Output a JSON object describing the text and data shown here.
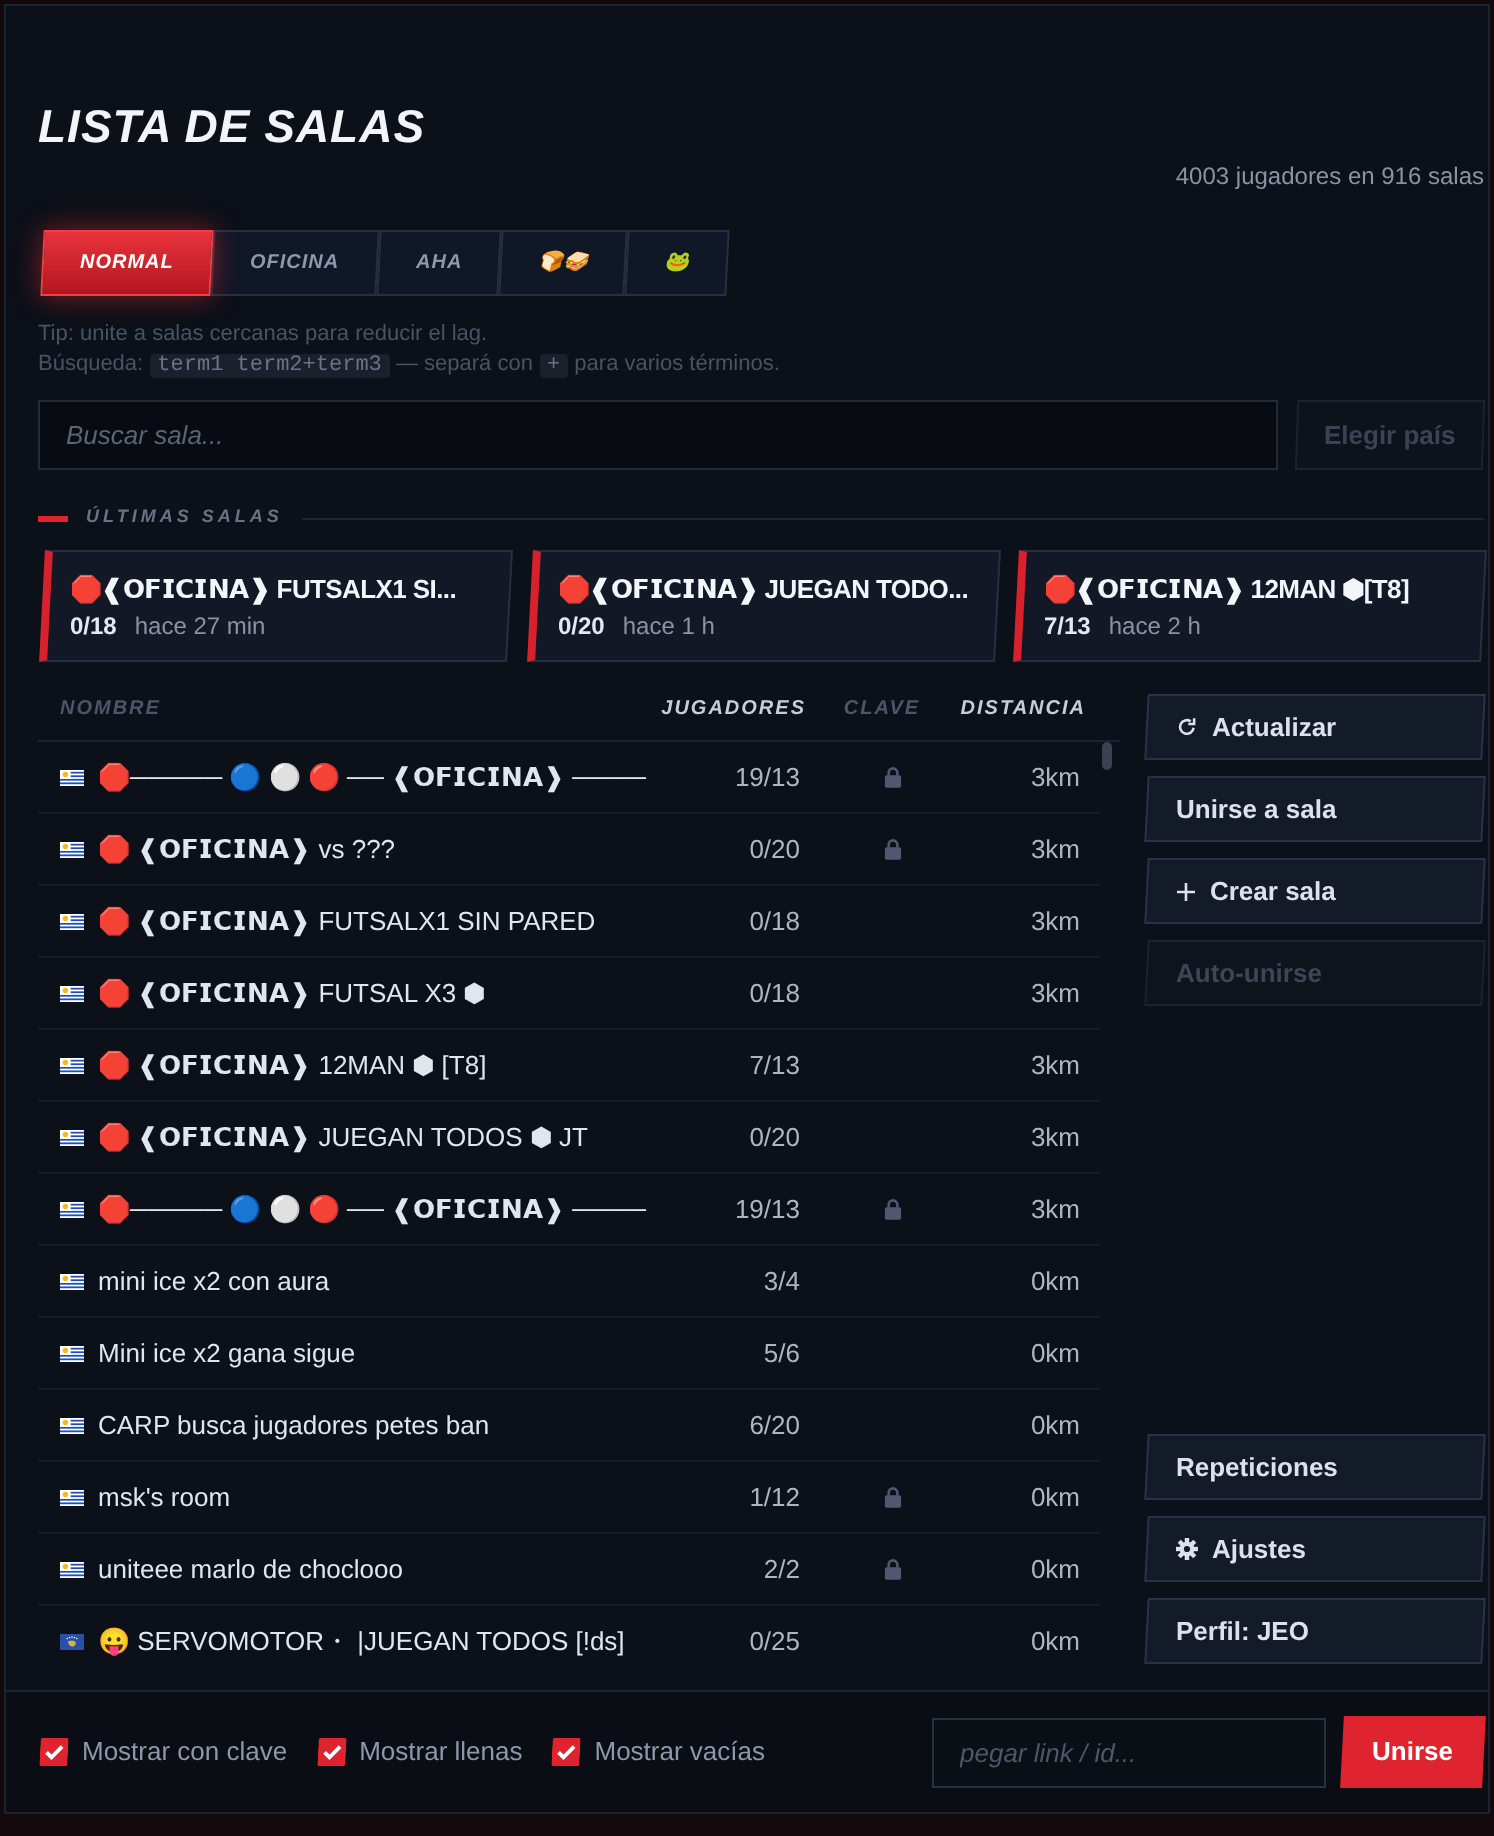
{
  "header": {
    "title": "LISTA DE SALAS",
    "stats": "4003 jugadores en 916 salas"
  },
  "tabs": [
    {
      "label": "NORMAL",
      "selected": true
    },
    {
      "label": "OFICINA",
      "selected": false
    },
    {
      "label": "AHA",
      "selected": false
    },
    {
      "label": "🍞🥪",
      "selected": false
    },
    {
      "label": "🐸",
      "selected": false
    }
  ],
  "tip": "Tip: unite a salas cercanas para reducir el lag.",
  "search_help": [
    {
      "kind": "text",
      "text": "Búsqueda:"
    },
    {
      "kind": "code",
      "text": "term1 term2+term3"
    },
    {
      "kind": "text",
      "text": "— separá con"
    },
    {
      "kind": "code",
      "text": "+"
    },
    {
      "kind": "text",
      "text": "para varios términos."
    }
  ],
  "search": {
    "placeholder": "Buscar sala..."
  },
  "country_button": {
    "label": "Elegir país",
    "disabled": true
  },
  "recent": {
    "title": "ÚLTIMAS SALAS",
    "rooms": [
      {
        "name": "🛑❰𝗢𝗙𝗜𝗖𝗜𝗡𝗔❱ FUTSALX1 SI...",
        "players": "0/18",
        "time": "hace 27 min"
      },
      {
        "name": "🛑❰𝗢𝗙𝗜𝗖𝗜𝗡𝗔❱ JUEGAN TODO...",
        "players": "0/20",
        "time": "hace 1 h"
      },
      {
        "name": "🛑❰𝗢𝗙𝗜𝗖𝗜𝗡𝗔❱ 12MAN ⬢[T8]",
        "players": "7/13",
        "time": "hace 2 h"
      }
    ]
  },
  "table": {
    "columns": [
      {
        "label": "NOMBRE",
        "active": false
      },
      {
        "label": "JUGADORES",
        "active": true
      },
      {
        "label": "CLAVE",
        "active": false
      },
      {
        "label": "DISTANCIA",
        "active": true
      }
    ],
    "rows": [
      {
        "kind": "uruguay",
        "name": "🛑───── 🔵 ⚪ 🔴 ── ❰𝗢𝗙𝗜𝗖𝗜𝗡𝗔❱ ────",
        "players": "19/13",
        "locked": true,
        "distance": "3km"
      },
      {
        "kind": "uruguay",
        "name": "🛑 ❰𝗢𝗙𝗜𝗖𝗜𝗡𝗔❱ vs ???",
        "players": "0/20",
        "locked": true,
        "distance": "3km"
      },
      {
        "kind": "uruguay",
        "name": "🛑 ❰𝗢𝗙𝗜𝗖𝗜𝗡𝗔❱ FUTSALX1 SIN PARED",
        "players": "0/18",
        "locked": false,
        "distance": "3km"
      },
      {
        "kind": "uruguay",
        "name": "🛑 ❰𝗢𝗙𝗜𝗖𝗜𝗡𝗔❱ FUTSAL X3 ⬢",
        "players": "0/18",
        "locked": false,
        "distance": "3km"
      },
      {
        "kind": "uruguay",
        "name": "🛑 ❰𝗢𝗙𝗜𝗖𝗜𝗡𝗔❱ 12MAN ⬢ [T8]",
        "players": "7/13",
        "locked": false,
        "distance": "3km"
      },
      {
        "kind": "uruguay",
        "name": "🛑 ❰𝗢𝗙𝗜𝗖𝗜𝗡𝗔❱ JUEGAN TODOS ⬢ JT",
        "players": "0/20",
        "locked": false,
        "distance": "3km"
      },
      {
        "kind": "uruguay",
        "name": "🛑───── 🔵 ⚪ 🔴 ── ❰𝗢𝗙𝗜𝗖𝗜𝗡𝗔❱ ────",
        "players": "19/13",
        "locked": true,
        "distance": "3km"
      },
      {
        "kind": "uruguay",
        "name": "mini ice x2 con aura",
        "players": "3/4",
        "locked": false,
        "distance": "0km"
      },
      {
        "kind": "uruguay",
        "name": "Mini ice x2 gana sigue",
        "players": "5/6",
        "locked": false,
        "distance": "0km"
      },
      {
        "kind": "uruguay",
        "name": "CARP busca jugadores petes ban",
        "players": "6/20",
        "locked": false,
        "distance": "0km"
      },
      {
        "kind": "uruguay",
        "name": "msk's room",
        "players": "1/12",
        "locked": true,
        "distance": "0km"
      },
      {
        "kind": "uruguay",
        "name": "uniteee marlo de choclooo",
        "players": "2/2",
        "locked": true,
        "distance": "0km"
      },
      {
        "kind": "kosovo",
        "name": "😛 SERVOMOTOR・ |JUEGAN TODOS [!ds]",
        "players": "0/25",
        "locked": false,
        "distance": "0km"
      }
    ]
  },
  "actions": [
    {
      "kind": "refresh",
      "label": "Actualizar",
      "disabled": false
    },
    {
      "kind": "join",
      "label": "Unirse a sala",
      "disabled": false
    },
    {
      "kind": "create",
      "label": "Crear sala",
      "disabled": false
    },
    {
      "kind": "auto",
      "label": "Auto-unirse",
      "disabled": true
    }
  ],
  "bottom_actions": [
    {
      "kind": "replays",
      "label": "Repeticiones",
      "disabled": false
    },
    {
      "kind": "settings",
      "label": "Ajustes",
      "disabled": false
    },
    {
      "kind": "profile",
      "label": "Perfil: JEO",
      "disabled": false
    }
  ],
  "filters": [
    {
      "label": "Mostrar con clave",
      "checked": true
    },
    {
      "label": "Mostrar llenas",
      "checked": true
    },
    {
      "label": "Mostrar vacías",
      "checked": true
    }
  ],
  "join": {
    "placeholder": "pegar link / id...",
    "button": "Unirse"
  }
}
